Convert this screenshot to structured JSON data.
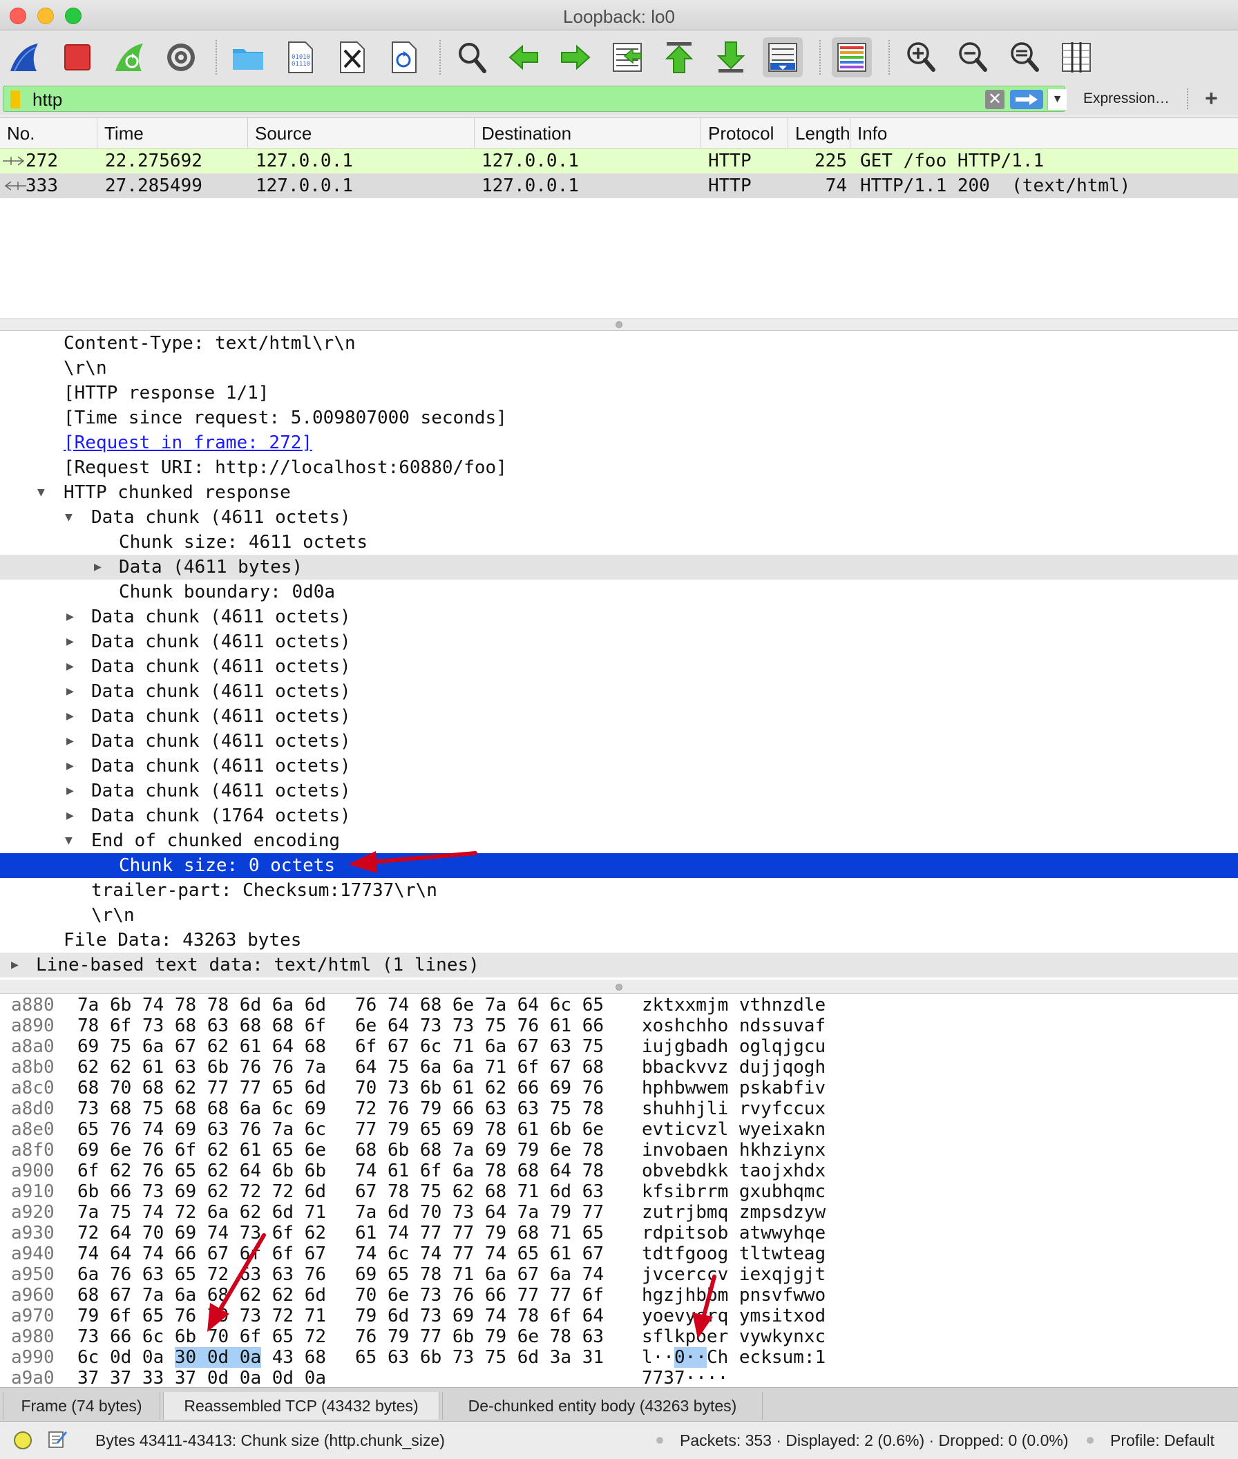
{
  "window": {
    "title": "Loopback: lo0"
  },
  "toolbar": {
    "icons": [
      "shark-fin-start-icon",
      "stop-capture-icon",
      "restart-capture-icon",
      "capture-options-icon",
      "open-file-icon",
      "save-file-icon",
      "close-file-icon",
      "reload-file-icon",
      "find-packet-icon",
      "go-back-icon",
      "go-forward-icon",
      "go-to-packet-icon",
      "go-first-icon",
      "go-last-icon",
      "auto-scroll-icon",
      "colorize-icon",
      "zoom-in-icon",
      "zoom-out-icon",
      "zoom-reset-icon",
      "resize-columns-icon"
    ]
  },
  "filter": {
    "value": "http",
    "expression_label": "Expression…",
    "clear_symbol": "✕",
    "plus_symbol": "+"
  },
  "packet_list": {
    "columns": [
      "No.",
      "Time",
      "Source",
      "Destination",
      "Protocol",
      "Length",
      "Info"
    ],
    "rows": [
      {
        "no": "272",
        "time": "22.275692",
        "source": "127.0.0.1",
        "destination": "127.0.0.1",
        "protocol": "HTTP",
        "length": "225",
        "info": "GET /foo HTTP/1.1"
      },
      {
        "no": "333",
        "time": "27.285499",
        "source": "127.0.0.1",
        "destination": "127.0.0.1",
        "protocol": "HTTP",
        "length": "74",
        "info": "HTTP/1.1 200  (text/html)"
      }
    ]
  },
  "details": {
    "rows": [
      {
        "text": "Content-Type: text/html\\r\\n"
      },
      {
        "text": "\\r\\n"
      },
      {
        "text": "[HTTP response 1/1]"
      },
      {
        "text": "[Time since request: 5.009807000 seconds]"
      },
      {
        "text": "[Request in frame: 272]"
      },
      {
        "text": "[Request URI: http://localhost:60880/foo]"
      },
      {
        "text": "HTTP chunked response"
      },
      {
        "text": "Data chunk (4611 octets)"
      },
      {
        "text": "Chunk size: 4611 octets"
      },
      {
        "text": "Data (4611 bytes)"
      },
      {
        "text": "Chunk boundary: 0d0a"
      },
      {
        "text": "Data chunk (4611 octets)"
      },
      {
        "text": "Data chunk (4611 octets)"
      },
      {
        "text": "Data chunk (4611 octets)"
      },
      {
        "text": "Data chunk (4611 octets)"
      },
      {
        "text": "Data chunk (4611 octets)"
      },
      {
        "text": "Data chunk (4611 octets)"
      },
      {
        "text": "Data chunk (4611 octets)"
      },
      {
        "text": "Data chunk (4611 octets)"
      },
      {
        "text": "Data chunk (1764 octets)"
      },
      {
        "text": "End of chunked encoding"
      },
      {
        "text": "Chunk size: 0 octets"
      },
      {
        "text": "trailer-part: Checksum:17737\\r\\n"
      },
      {
        "text": "\\r\\n"
      },
      {
        "text": "File Data: 43263 bytes"
      },
      {
        "text": "Line-based text data: text/html (1 lines)"
      }
    ]
  },
  "bytes": {
    "rows": [
      {
        "offset": "a880",
        "hex1": "7a 6b 74 78 78 6d 6a 6d",
        "hex2": "76 74 68 6e 7a 64 6c 65",
        "ascii": "zktxxmjm vthnzdle"
      },
      {
        "offset": "a890",
        "hex1": "78 6f 73 68 63 68 68 6f",
        "hex2": "6e 64 73 73 75 76 61 66",
        "ascii": "xoshchho ndssuvaf"
      },
      {
        "offset": "a8a0",
        "hex1": "69 75 6a 67 62 61 64 68",
        "hex2": "6f 67 6c 71 6a 67 63 75",
        "ascii": "iujgbadh oglqjgcu"
      },
      {
        "offset": "a8b0",
        "hex1": "62 62 61 63 6b 76 76 7a",
        "hex2": "64 75 6a 6a 71 6f 67 68",
        "ascii": "bbackvvz dujjqogh"
      },
      {
        "offset": "a8c0",
        "hex1": "68 70 68 62 77 77 65 6d",
        "hex2": "70 73 6b 61 62 66 69 76",
        "ascii": "hphbwwem pskabfiv"
      },
      {
        "offset": "a8d0",
        "hex1": "73 68 75 68 68 6a 6c 69",
        "hex2": "72 76 79 66 63 63 75 78",
        "ascii": "shuhhjli rvyfccux"
      },
      {
        "offset": "a8e0",
        "hex1": "65 76 74 69 63 76 7a 6c",
        "hex2": "77 79 65 69 78 61 6b 6e",
        "ascii": "evticvzl wyeixakn"
      },
      {
        "offset": "a8f0",
        "hex1": "69 6e 76 6f 62 61 65 6e",
        "hex2": "68 6b 68 7a 69 79 6e 78",
        "ascii": "invobaen hkhziynx"
      },
      {
        "offset": "a900",
        "hex1": "6f 62 76 65 62 64 6b 6b",
        "hex2": "74 61 6f 6a 78 68 64 78",
        "ascii": "obvebdkk taojxhdx"
      },
      {
        "offset": "a910",
        "hex1": "6b 66 73 69 62 72 72 6d",
        "hex2": "67 78 75 62 68 71 6d 63",
        "ascii": "kfsibrrm gxubhqmc"
      },
      {
        "offset": "a920",
        "hex1": "7a 75 74 72 6a 62 6d 71",
        "hex2": "7a 6d 70 73 64 7a 79 77",
        "ascii": "zutrjbmq zmpsdzyw"
      },
      {
        "offset": "a930",
        "hex1": "72 64 70 69 74 73 6f 62",
        "hex2": "61 74 77 77 79 68 71 65",
        "ascii": "rdpitsob atwwyhqe"
      },
      {
        "offset": "a940",
        "hex1": "74 64 74 66 67 6f 6f 67",
        "hex2": "74 6c 74 77 74 65 61 67",
        "ascii": "tdtfgoog tltwteag"
      },
      {
        "offset": "a950",
        "hex1": "6a 76 63 65 72 63 63 76",
        "hex2": "69 65 78 71 6a 67 6a 74",
        "ascii": "jvcerccv iexqjgjt"
      },
      {
        "offset": "a960",
        "hex1": "68 67 7a 6a 68 62 62 6d",
        "hex2": "70 6e 73 76 66 77 77 6f",
        "ascii": "hgzjhbbm pnsvfwwo"
      },
      {
        "offset": "a970",
        "hex1": "79 6f 65 76 79 73 72 71",
        "hex2": "79 6d 73 69 74 78 6f 64",
        "ascii": "yoevysrq ymsitxod"
      },
      {
        "offset": "a980",
        "hex1": "73 66 6c 6b 70 6f 65 72",
        "hex2": "76 79 77 6b 79 6e 78 63",
        "ascii": "sflkpoer vywkynxc"
      },
      {
        "offset": "a990",
        "hex1_pre": "6c 0d 0a ",
        "hex1_sel": "30 0d 0a",
        "hex1_post": " 43 68",
        "hex2": "65 63 6b 73 75 6d 3a 31",
        "ascii_pre": "l··",
        "ascii_sel": "0··",
        "ascii_post": "Ch ecksum:1"
      },
      {
        "offset": "a9a0",
        "hex1": "37 37 33 37 0d 0a 0d 0a",
        "hex2": "",
        "ascii": "7737····"
      }
    ]
  },
  "byte_tabs": [
    "Frame (74 bytes)",
    "Reassembled TCP (43432 bytes)",
    "De-chunked entity body (43263 bytes)"
  ],
  "status": {
    "message": "Bytes 43411-43413: Chunk size (http.chunk_size)",
    "packets": "Packets: 353 · Displayed: 2 (0.6%) · Dropped: 0 (0.0%)",
    "profile": "Profile: Default"
  },
  "colors": {
    "filter_valid": "#a0f09a",
    "request_row": "#e4ffc7",
    "selection": "#0a3ed8",
    "byte_highlight": "#a8cff5",
    "annotation_arrow": "#d0021b"
  }
}
